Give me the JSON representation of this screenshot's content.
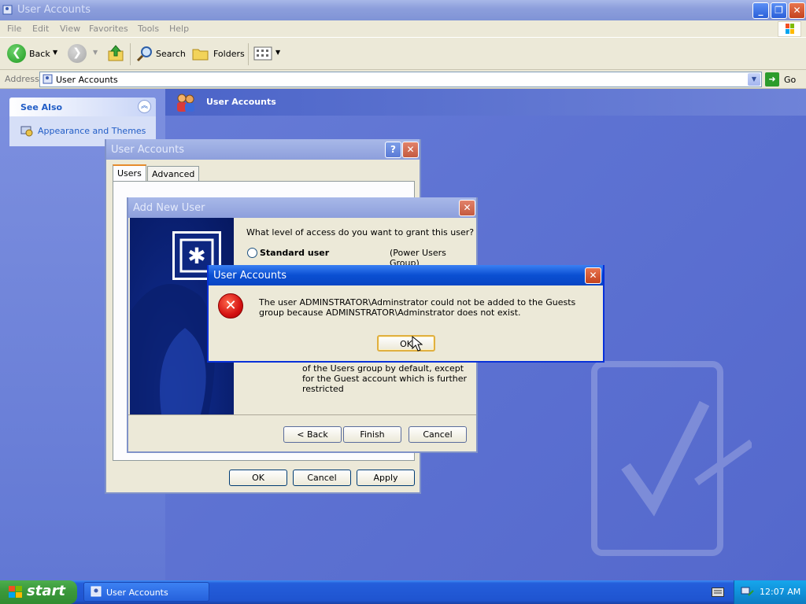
{
  "explorer": {
    "title": "User Accounts",
    "menu": [
      "File",
      "Edit",
      "View",
      "Favorites",
      "Tools",
      "Help"
    ],
    "toolbar": {
      "back_label": "Back",
      "search_label": "Search",
      "folders_label": "Folders"
    },
    "address": {
      "label": "Address",
      "value": "User Accounts",
      "go_label": "Go"
    },
    "see_also": {
      "title": "See Also",
      "link": "Appearance and Themes"
    },
    "banner_title": "User Accounts"
  },
  "ua_props": {
    "title": "User Accounts",
    "tabs": [
      "Users",
      "Advanced"
    ],
    "buttons": {
      "ok": "OK",
      "cancel": "Cancel",
      "apply": "Apply"
    }
  },
  "add_user": {
    "title": "Add New User",
    "question": "What level of access do you want to grant this user?",
    "option_label": "Standard user",
    "option_group": "(Power Users Group)",
    "description": "of the Users group by default, except for the Guest account which is further restricted",
    "buttons": {
      "back": "< Back",
      "finish": "Finish",
      "cancel": "Cancel"
    }
  },
  "error_dialog": {
    "title": "User Accounts",
    "message": "The user ADMINSTRATOR\\Adminstrator could not be added to the Guests group because ADMINSTRATOR\\Adminstrator does not exist.",
    "ok_label": "OK"
  },
  "taskbar": {
    "start_label": "start",
    "task_label": "User Accounts",
    "clock": "12:07 AM"
  },
  "colors": {
    "xp_title_blue": "#0a4fd2",
    "inactive_title": "#8d9fdc",
    "desktop_blue": "#5d72d2",
    "start_green": "#3c9a3c",
    "error_red": "#d41212"
  }
}
